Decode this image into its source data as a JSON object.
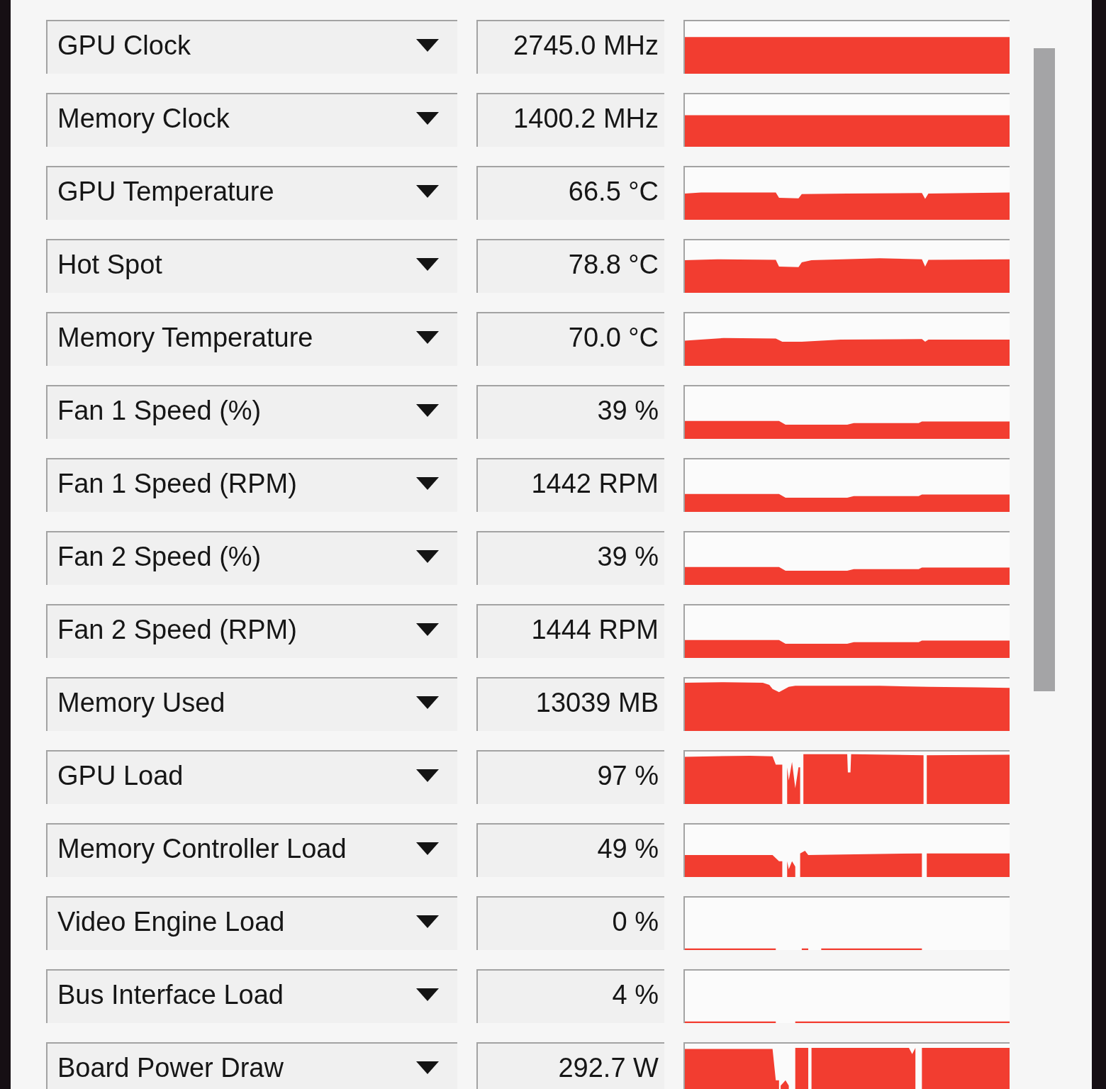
{
  "sensors": [
    {
      "name": "GPU Clock",
      "value": "2745.0 MHz"
    },
    {
      "name": "Memory Clock",
      "value": "1400.2 MHz"
    },
    {
      "name": "GPU Temperature",
      "value": "66.5 °C"
    },
    {
      "name": "Hot Spot",
      "value": "78.8 °C"
    },
    {
      "name": "Memory Temperature",
      "value": "70.0 °C"
    },
    {
      "name": "Fan 1 Speed (%)",
      "value": "39 %"
    },
    {
      "name": "Fan 1 Speed (RPM)",
      "value": "1442 RPM"
    },
    {
      "name": "Fan 2 Speed (%)",
      "value": "39 %"
    },
    {
      "name": "Fan 2 Speed (RPM)",
      "value": "1444 RPM"
    },
    {
      "name": "Memory Used",
      "value": "13039 MB"
    },
    {
      "name": "GPU Load",
      "value": "97 %"
    },
    {
      "name": "Memory Controller Load",
      "value": "49 %"
    },
    {
      "name": "Video Engine Load",
      "value": "0 %"
    },
    {
      "name": "Bus Interface Load",
      "value": "4 %"
    },
    {
      "name": "Board Power Draw",
      "value": "292.7 W"
    }
  ]
}
